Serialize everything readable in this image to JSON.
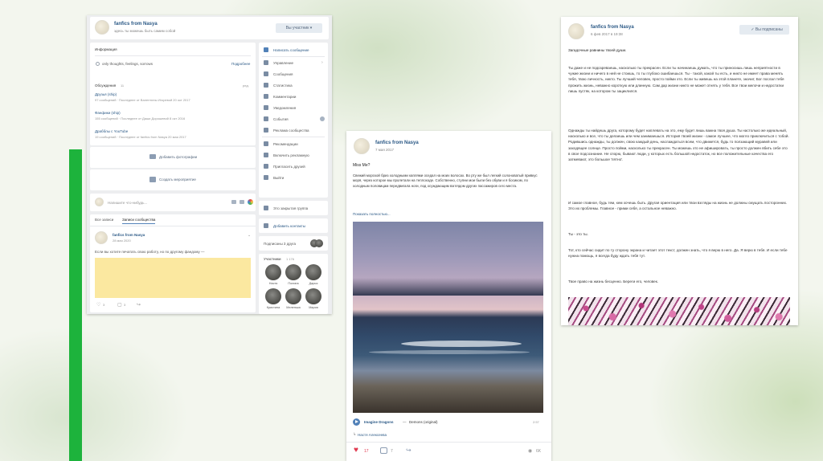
{
  "shot1": {
    "header": {
      "name": "fanfics from Nasya",
      "status": "здесь ты можешь быть самим собой",
      "button": "Вы участник ▾"
    },
    "info": {
      "title": "Информация",
      "text": "only thoughts, feelings, sorrows",
      "link": "Подробнее"
    },
    "discussions": {
      "title": "Обсуждения",
      "count": "11",
      "edit": "ред.",
      "items": [
        {
          "title": "Друзья (ship)",
          "meta": "97 сообщений · Последнее от Валентины Игоревой 20 окт 2017"
        },
        {
          "title": "Фанфики (ship)",
          "meta": "155 сообщений · Последнее от Даши Дорошевой 8 окт 2016"
        },
        {
          "title": "Драбблы с YouTube",
          "meta": "19 сообщений · Последнее от fanfics from Nasya 20 мая 2017"
        }
      ]
    },
    "add_photo": "Добавить фотографии",
    "create_event": "Создать мероприятие",
    "compose_placeholder": "Напишите что-нибудь...",
    "wall_tabs": [
      "Все записи",
      "Записи сообщества"
    ],
    "post": {
      "author": "fanfics from Nasya",
      "date": "28 мая 2020",
      "text": "Если вы хотите печатать свою работу, но по другому фандому —",
      "likes": "3",
      "comments": "3",
      "highlight_color": "#fbe8a0"
    },
    "menu": [
      {
        "icon": "message-icon",
        "label": "Написать сообщение"
      },
      {
        "icon": "gear-icon",
        "label": "Управление"
      },
      {
        "icon": "chat-icon",
        "label": "Сообщения"
      },
      {
        "icon": "chart-icon",
        "label": "Статистика"
      },
      {
        "icon": "comment-icon",
        "label": "Комментарии"
      },
      {
        "icon": "bell-icon",
        "label": "Уведомления"
      },
      {
        "icon": "calendar-icon",
        "label": "События"
      },
      {
        "icon": "star-icon",
        "label": "Реклама сообщества"
      },
      {
        "icon": "thumb-icon",
        "label": "Рекомендации"
      },
      {
        "icon": "chat-icon",
        "label": "Включить рекламную"
      },
      {
        "icon": "user-add-icon",
        "label": "Пригласить друзей"
      },
      {
        "icon": "exit-icon",
        "label": "Выйти"
      }
    ],
    "hidden_group": "Это закрытая группа",
    "add_contact": "Добавить контакты",
    "friends_subscribed": "Подписаны 3 друга",
    "members": {
      "title": "Участники",
      "count": "1 176",
      "names": [
        "Настя",
        "Полина",
        "Дарья",
        "Кристина",
        "Меленька",
        "Мария"
      ]
    }
  },
  "shot2": {
    "author": "fanfics from Nasya",
    "date": "7 мая 2017",
    "title": "Miss Me?",
    "body": "Свежий морской бриз холодными каплями оседал на моих волосах. Во рту же был легкий солоноватый привкус моря, через которое мы пролетали на теплоходе. Собственно, ступни мои были без обуви и я босиком, по холодным половицам передвигала ноги, под осуждающим взглядом других пассажиров сего места.",
    "show_more": "Показать полностью...",
    "audio": {
      "artist": "Imagine Dragons",
      "dash": "—",
      "title": "Demons (original)",
      "duration": "2:57"
    },
    "repost_author": "Настя Алексеева",
    "likes": "17",
    "comments": "7",
    "views": "6K"
  },
  "shot3": {
    "author": "fanfics from Nasya",
    "date": "6 фев 2017 в 19:38",
    "button": "Вы подписаны",
    "title": "Загадочные равнины твоей души.",
    "para1": "Ты даже и не подозреваешь, насколько ты прекрасен. Если ты начинаешь думать, что ты приносишь лишь неприятности в чужие жизни и ничего в ней не стоишь, то ты глубоко ошибаешься. Ты - такой, какой ты есть, и никто не имеет права менять тебя, твою личность, никто. Ты лучший человек, просто пойми это. Если ты живешь на этой планете, значит, Бог послал тебя прожить жизнь, неважно короткую или длинную. Сам дар жизни никто не может отнять у тебя. Все твои мелочи и недостатки лишь пустяк, на котором ты зациклился.",
    "para2": "Однажды ты найдешь друга, которому будет наплевать на это, ему будет лишь важна твоя душа. Ты настолько же идеальный, насколько и все, что ты делаешь или чем занимаешься. История твоей жизни - самое лучшее, что могло приключиться с тобой. Родившись однажды, ты должен, свою каждый день, наслаждаться всем, что движется, будь то ползающий муравей или заходящее солнце. Просто пойми, насколько ты прекрасен. Ты можешь это не афишировать, ты просто должен вбить себе это в свое подсознание. Не спорю, бывают люди, у которых есть большой недостаток, но все положительные качества его затмевают, это большое 'пятно'.",
    "para3": "И самое главное, будь тем, кем хочешь быть. Другая ориентация или твои взгляды на жизнь не должны смущать посторонних. Это их проблемы. Главное - прими себя, а остальное неважно.",
    "para4": "Ты - это ты.",
    "para5": "Тот, кто сейчас сидит по ту сторону экрана и читает этот текст, должен знать, что я верю в него. Да. Я верю в тебя. И если тебе нужна помощь, я всегда буду ждать тебя тут.",
    "para6": "Твое право на жизнь бесценно. Береги его, человек."
  },
  "colors": {
    "accent_green": "#1db33c",
    "link_blue": "#2a5885",
    "like_red": "#e0384f"
  }
}
